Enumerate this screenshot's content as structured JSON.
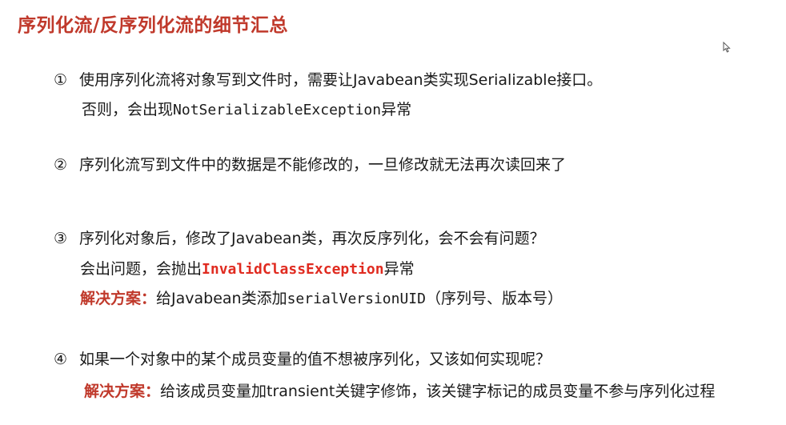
{
  "title": "序列化流/反序列化流的细节汇总",
  "items": [
    {
      "number": "①",
      "text": "使用序列化流将对象写到文件时，需要让Javabean类实现Serializable接口。",
      "note_prefix": "否则，会出现",
      "note_code": "NotSerializableException",
      "note_suffix": "异常"
    },
    {
      "number": "②",
      "text": "序列化流写到文件中的数据是不能修改的，一旦修改就无法再次读回来了"
    },
    {
      "number": "③",
      "text": "序列化对象后，修改了Javabean类，再次反序列化，会不会有问题？",
      "answer_prefix": "会出问题，会抛出",
      "answer_code": "InvalidClassException",
      "answer_suffix": "异常",
      "solution_label": "解决方案：",
      "solution_prefix": "给Javabean类添加",
      "solution_code": "serialVersionUID",
      "solution_suffix": "（序列号、版本号）"
    },
    {
      "number": "④",
      "text": "如果一个对象中的某个成员变量的值不想被序列化，又该如何实现呢？",
      "solution_label": "解决方案：",
      "solution_text": "给该成员变量加transient关键字修饰，该关键字标记的成员变量不参与序列化过程"
    }
  ]
}
